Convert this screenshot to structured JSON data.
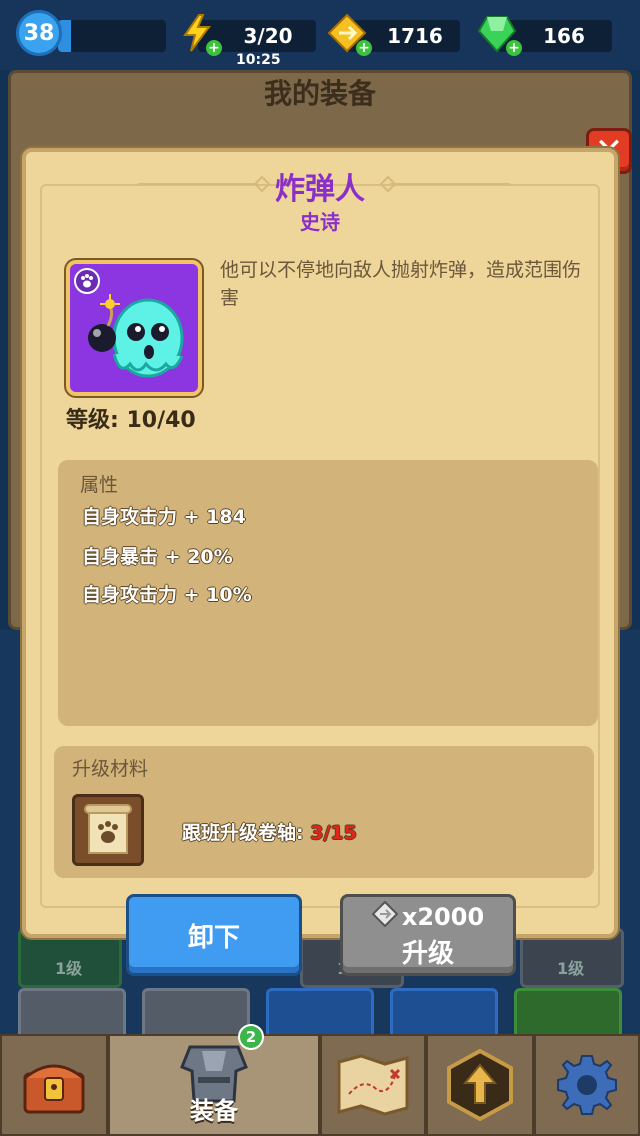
{
  "topbar": {
    "level": "38",
    "xp_fraction": 0.12,
    "energy": "3/20",
    "energy_timer": "10:25",
    "gold": "1716",
    "gems": "166"
  },
  "background": {
    "title": "我的装备",
    "slot_label": "1级"
  },
  "dialog": {
    "title": "炸弹人",
    "rarity": "史诗",
    "description": "他可以不停地向敌人抛射炸弹，造成范围伤害",
    "level": "等级: 10/40",
    "attributes_header": "属性",
    "attributes": [
      "自身攻击力 + 184",
      "自身暴击 + 20%",
      "自身攻击力 + 10%"
    ],
    "materials_header": "升级材料",
    "material_name": "跟班升级卷轴: ",
    "material_count": "3/15",
    "close_label": "✕"
  },
  "buttons": {
    "unequip": "卸下",
    "upgrade_cost": "x2000",
    "upgrade": "升级"
  },
  "nav": {
    "equipment_label": "装备",
    "equipment_badge": "2"
  },
  "colors": {
    "rarity_epic": "#8a2fc9",
    "material_count": "#e0251c",
    "unequip_button": "#3f9cf0",
    "upgrade_button_disabled": "#8f8f8f"
  }
}
